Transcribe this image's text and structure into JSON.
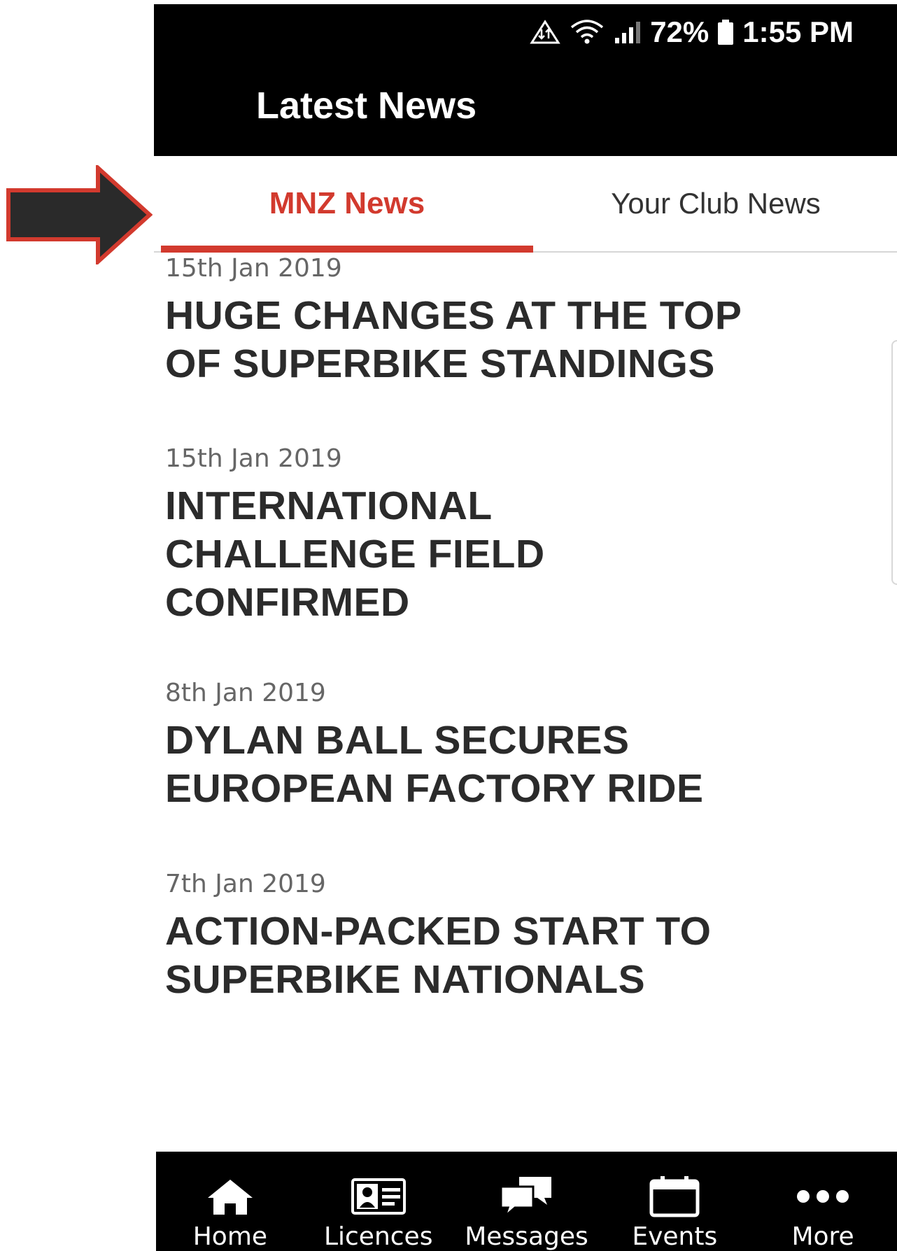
{
  "status_bar": {
    "battery": "72%",
    "time": "1:55 PM"
  },
  "header": {
    "title": "Latest News"
  },
  "tabs": [
    {
      "label": "MNZ News",
      "active": true
    },
    {
      "label": "Your Club News",
      "active": false
    }
  ],
  "news": [
    {
      "date": "15th Jan 2019",
      "headline_lines": [
        "HUGE CHANGES AT THE TOP",
        "OF SUPERBIKE STANDINGS"
      ]
    },
    {
      "date": "15th Jan 2019",
      "headline_lines": [
        "INTERNATIONAL",
        "CHALLENGE FIELD",
        "CONFIRMED"
      ]
    },
    {
      "date": "8th Jan 2019",
      "headline_lines": [
        "DYLAN BALL SECURES",
        "EUROPEAN FACTORY RIDE"
      ]
    },
    {
      "date": "7th Jan 2019",
      "headline_lines": [
        "ACTION-PACKED START TO",
        "SUPERBIKE NATIONALS"
      ]
    }
  ],
  "bottom_nav": [
    {
      "label": "Home",
      "icon": "home-icon"
    },
    {
      "label": "Licences",
      "icon": "id-card-icon"
    },
    {
      "label": "Messages",
      "icon": "chat-bubbles-icon"
    },
    {
      "label": "Events",
      "icon": "calendar-icon"
    },
    {
      "label": "More",
      "icon": "more-dots-icon"
    }
  ],
  "colors": {
    "accent": "#d23a2e",
    "bar_background": "#000000",
    "headline_text": "#2b2b2b",
    "annotation_arrow_fill": "#2a2a2a",
    "annotation_arrow_border": "#d23a2e"
  }
}
